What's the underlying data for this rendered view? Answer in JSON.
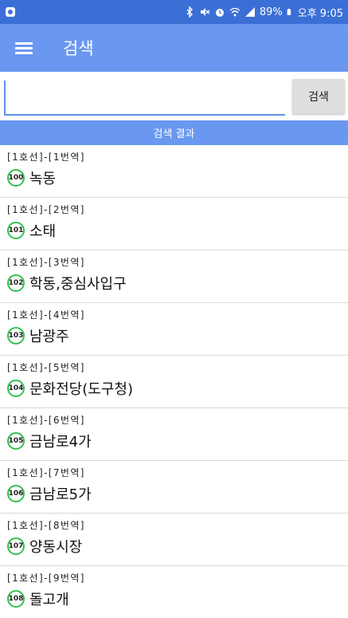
{
  "status_bar": {
    "battery_percent": "89%",
    "time": "오후 9:05",
    "left_icon": "app-notification-icon",
    "icons": [
      "bluetooth-icon",
      "mute-icon",
      "alarm-icon",
      "wifi-icon",
      "signal-icon",
      "battery-icon"
    ]
  },
  "app_bar": {
    "title": "검색",
    "menu_icon": "hamburger-menu-icon"
  },
  "search": {
    "value": "",
    "placeholder": "",
    "button_label": "검색"
  },
  "results": {
    "header": "검색 결과",
    "items": [
      {
        "line": "[1호선]-[1번역]",
        "code": "100",
        "name": "녹동"
      },
      {
        "line": "[1호선]-[2번역]",
        "code": "101",
        "name": "소태"
      },
      {
        "line": "[1호선]-[3번역]",
        "code": "102",
        "name": "학동,중심사입구"
      },
      {
        "line": "[1호선]-[4번역]",
        "code": "103",
        "name": "남광주"
      },
      {
        "line": "[1호선]-[5번역]",
        "code": "104",
        "name": "문화전당(도구청)"
      },
      {
        "line": "[1호선]-[6번역]",
        "code": "105",
        "name": "금남로4가"
      },
      {
        "line": "[1호선]-[7번역]",
        "code": "106",
        "name": "금남로5가"
      },
      {
        "line": "[1호선]-[8번역]",
        "code": "107",
        "name": "양동시장"
      },
      {
        "line": "[1호선]-[9번역]",
        "code": "108",
        "name": "돌고개"
      }
    ]
  },
  "colors": {
    "status_bar": "#3b6fd6",
    "app_bar": "#6a97f0",
    "badge_ring": "#33c24d",
    "input_underline": "#5f8fe8"
  }
}
